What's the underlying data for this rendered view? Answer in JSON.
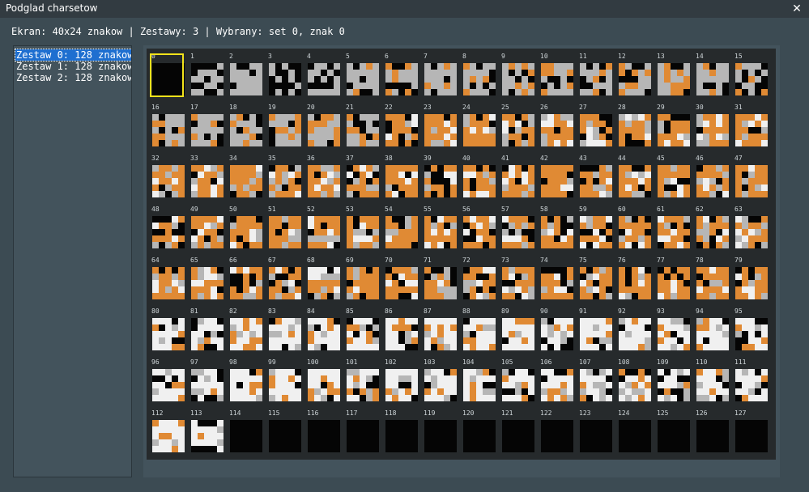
{
  "window": {
    "title": "Podglad charsetow"
  },
  "info_line": "Ekran: 40x24 znakow | Zestawy: 3 | Wybrany: set 0, znak 0",
  "sets": [
    {
      "label": "Zestaw 0: 128 znakow,",
      "selected": true
    },
    {
      "label": "Zestaw 1: 128 znakow,",
      "selected": false
    },
    {
      "label": "Zestaw 2: 128 znakow,",
      "selected": false
    }
  ],
  "charset": {
    "count": 128,
    "selected_index": 0,
    "empty_from": 114,
    "palette": {
      "black": "#050505",
      "gray": "#b6b6b6",
      "orange": "#e08a34",
      "white": "#f0f0f0",
      "selection": "#f2e21b"
    }
  }
}
